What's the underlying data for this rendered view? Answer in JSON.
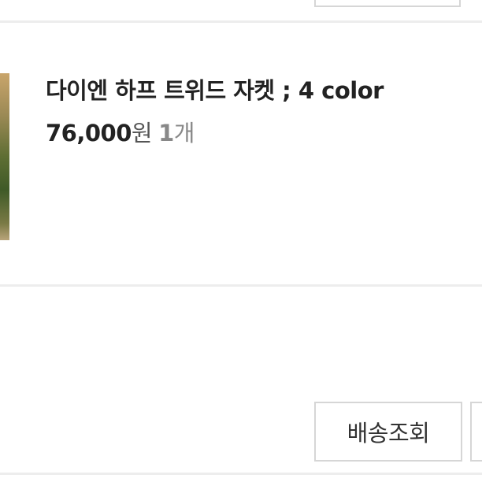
{
  "order_item": {
    "title": "다이엔 하프 트위드 자켓 ; 4 color",
    "price_amount": "76,000",
    "price_unit": "원",
    "quantity_number": "1",
    "quantity_unit": "개"
  },
  "actions": {
    "track_delivery_label": "배송조회"
  },
  "colors": {
    "divider": "#ededed",
    "button_border": "#d6d6d6",
    "text_primary": "#222222",
    "text_muted": "#888888"
  }
}
